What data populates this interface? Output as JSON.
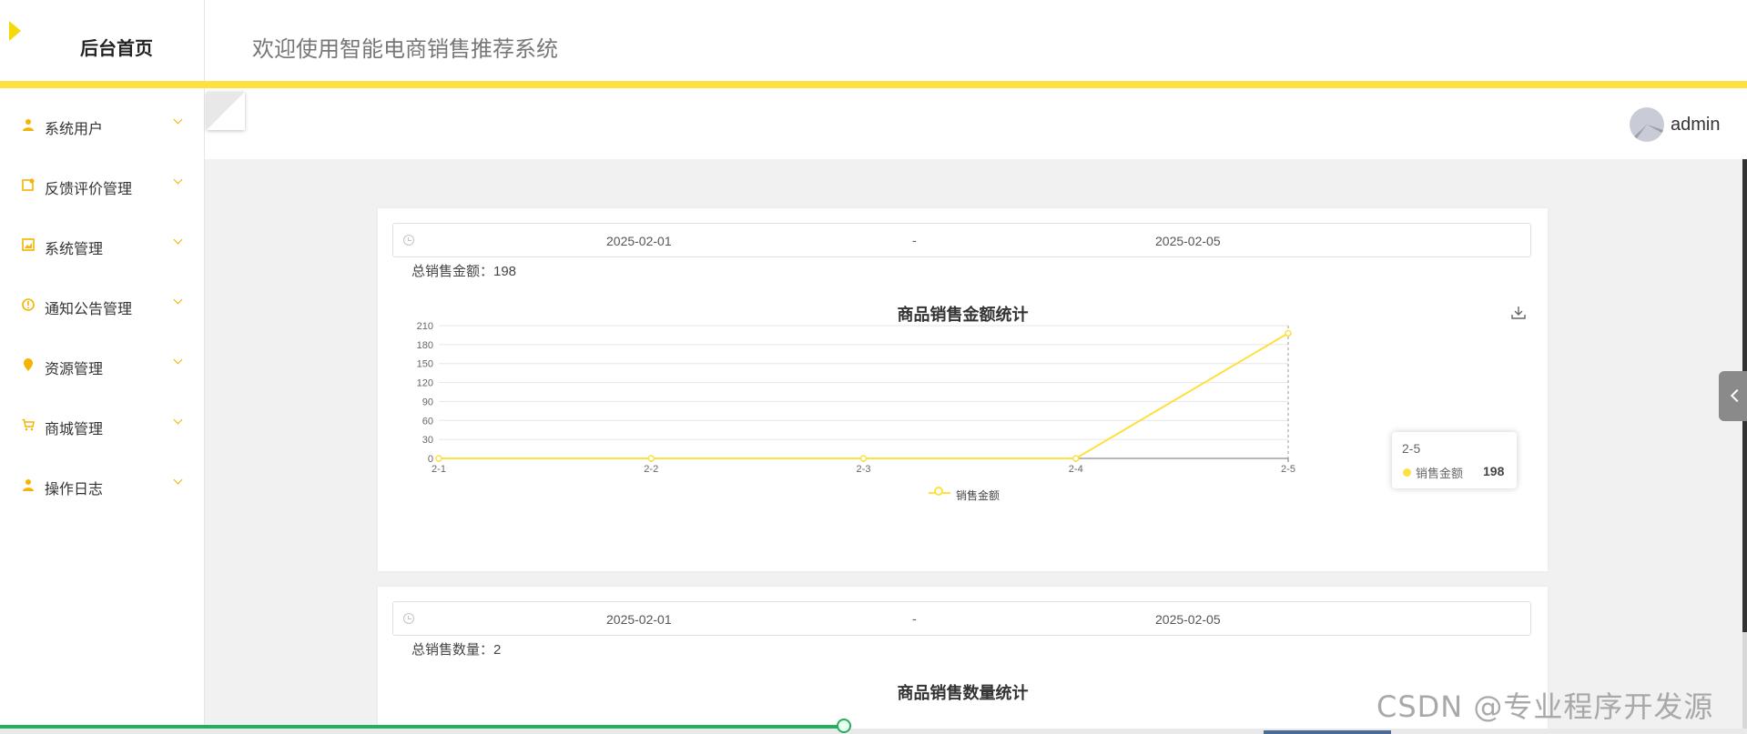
{
  "sidebar": {
    "brand": "后台首页",
    "items": [
      {
        "label": "系统用户",
        "icon": "user-icon"
      },
      {
        "label": "反馈评价管理",
        "icon": "feedback-icon"
      },
      {
        "label": "系统管理",
        "icon": "image-icon"
      },
      {
        "label": "通知公告管理",
        "icon": "info-icon"
      },
      {
        "label": "资源管理",
        "icon": "location-icon"
      },
      {
        "label": "商城管理",
        "icon": "cart-icon"
      },
      {
        "label": "操作日志",
        "icon": "user-icon"
      }
    ]
  },
  "header": {
    "title": "欢迎使用智能电商销售推荐系统",
    "user": "admin"
  },
  "colors": {
    "accent": "#fee140",
    "chart_line": "#fee140"
  },
  "card1": {
    "range_start": "2025-02-01",
    "range_sep": "-",
    "range_end": "2025-02-05",
    "total": "总销售金额：198",
    "title": "商品销售金额统计",
    "tooltip": {
      "title": "2-5",
      "name": "销售金额",
      "value": "198"
    },
    "legend": "销售金额"
  },
  "card2": {
    "range_start": "2025-02-01",
    "range_sep": "-",
    "range_end": "2025-02-05",
    "total": "总销售数量：2",
    "title": "商品销售数量统计"
  },
  "chart_data": {
    "type": "line",
    "title": "商品销售金额统计",
    "categories": [
      "2-1",
      "2-2",
      "2-3",
      "2-4",
      "2-5"
    ],
    "series": [
      {
        "name": "销售金额",
        "values": [
          0,
          0,
          0,
          0,
          198
        ]
      }
    ],
    "yticks": [
      "0",
      "30",
      "60",
      "90",
      "120",
      "150",
      "180",
      "210"
    ],
    "ylim": [
      0,
      210
    ],
    "grid": true,
    "legend": "bottom-center"
  },
  "watermark": "CSDN @专业程序开发源"
}
